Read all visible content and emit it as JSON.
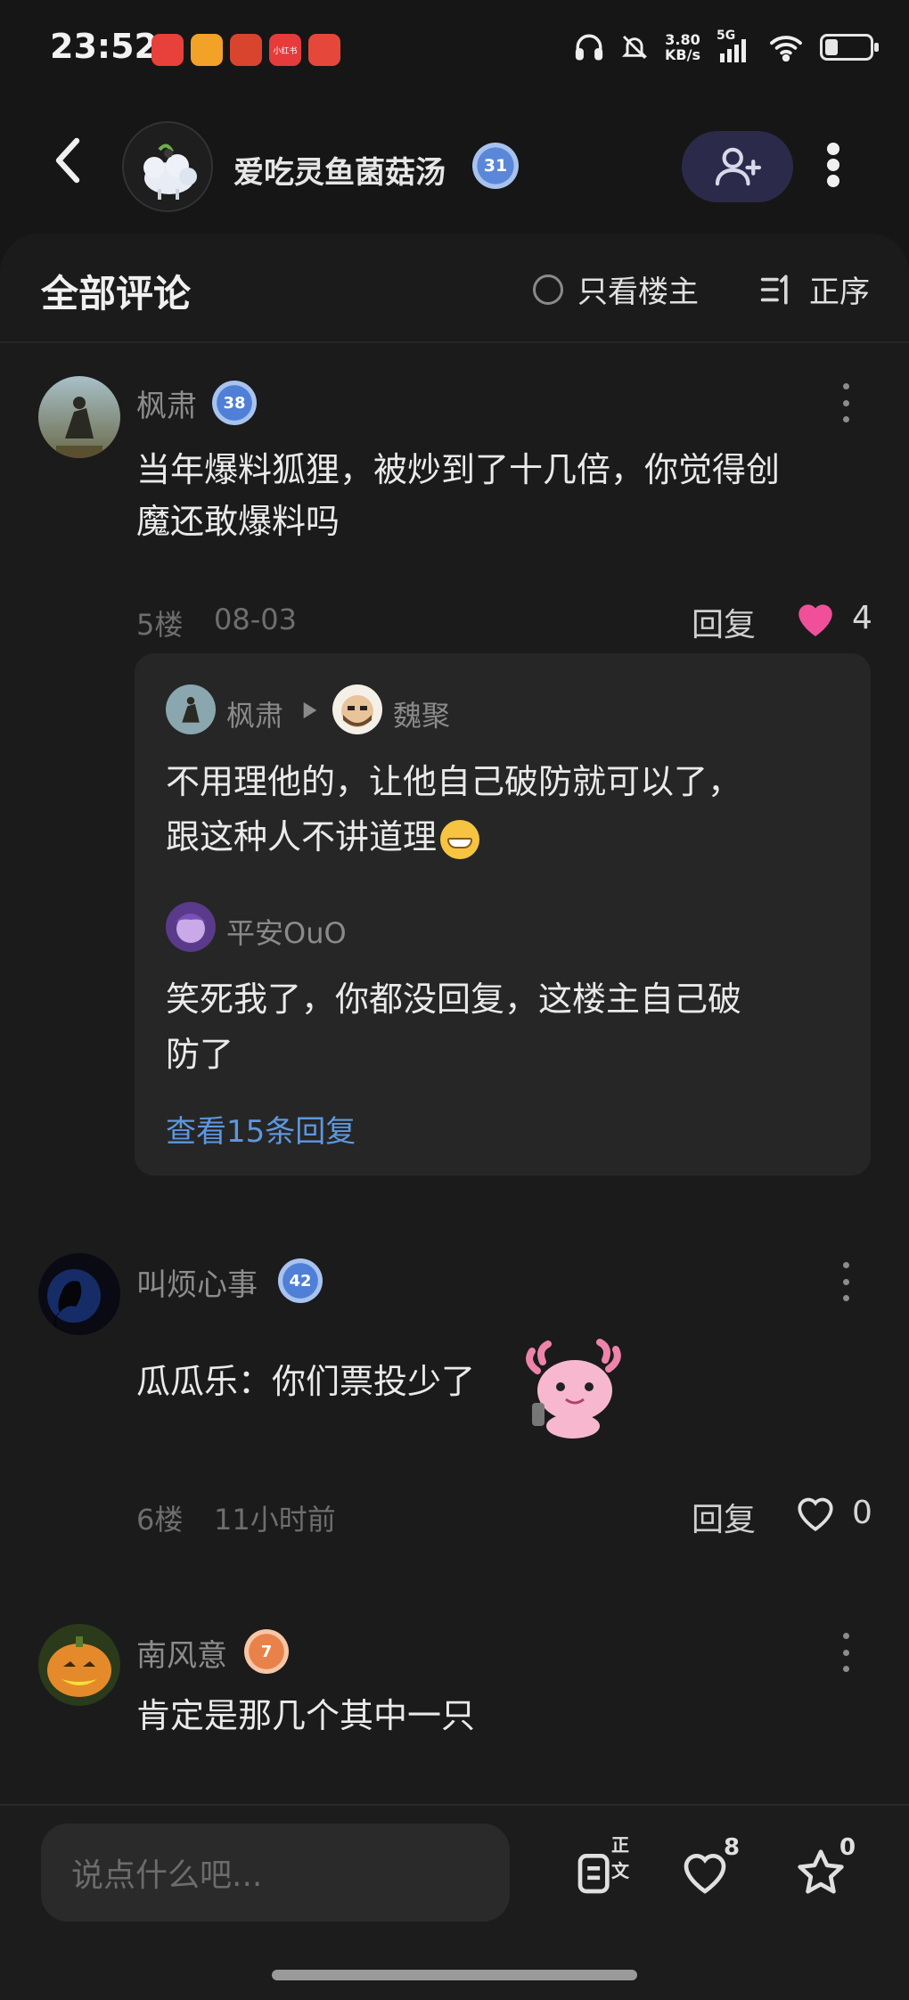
{
  "status_bar": {
    "time": "23:52",
    "net_speed_value": "3.80",
    "net_speed_unit": "KB/s",
    "network": "5G",
    "app_icons": [
      "app-red-icon",
      "app-orange-icon",
      "app-red-box-icon",
      "app-red-tag-icon",
      "app-alarm-icon"
    ],
    "small_app_label": "小红书"
  },
  "header": {
    "author_name": "爱吃灵鱼菌菇汤",
    "author_level": "31"
  },
  "comments_panel": {
    "title": "全部评论",
    "op_only_label": "只看楼主",
    "sort_label": "正序"
  },
  "comments": [
    {
      "name": "枫肃",
      "level": "38",
      "text_line1": "当年爆料狐狸，被炒到了十几倍，你觉得创",
      "text_line2": "魔还敢爆料吗",
      "floor": "5楼",
      "time": "08-03",
      "reply_label": "回复",
      "likes": "4",
      "liked": true
    },
    {
      "name": "叫烦心事",
      "level": "42",
      "text": "瓜瓜乐：你们票投少了",
      "floor": "6楼",
      "time": "11小时前",
      "reply_label": "回复",
      "likes": "0",
      "liked": false
    },
    {
      "name": "南风意",
      "level": "7",
      "text": "肯定是那几个其中一只"
    }
  ],
  "replies": {
    "first": {
      "from": "枫肃",
      "to": "魏聚",
      "text_line1": "不用理他的，让他自己破防就可以了，",
      "text_line2": "跟这种人不讲道理"
    },
    "second": {
      "from": "平安OuO",
      "text_line1": "笑死我了，你都没回复，这楼主自己破",
      "text_line2": "防了"
    },
    "view_more": "查看15条回复"
  },
  "bottom_bar": {
    "input_placeholder": "说点什么吧...",
    "doc_badge": "正文",
    "like_count": "8",
    "star_count": "0"
  },
  "colors": {
    "background": "#161616",
    "accent_blue": "#5e97e0",
    "like_pink": "#f0509a",
    "follow_bg": "#2c2a4a"
  }
}
